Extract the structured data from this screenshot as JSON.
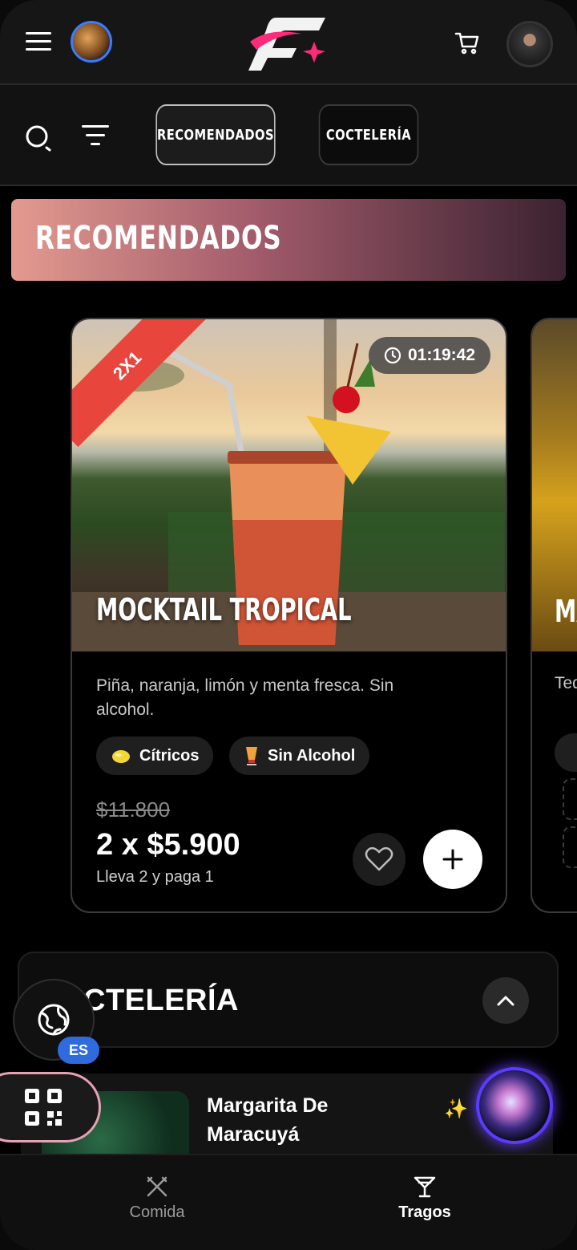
{
  "header": {
    "menu_icon": "hamburger-menu-icon",
    "venue_icon": "planet-icon",
    "logo": "brand-logo",
    "cart_icon": "shopping-cart-icon",
    "avatar_icon": "user-avatar"
  },
  "filters": {
    "search_icon": "search-icon",
    "filter_icon": "filter-icon",
    "tabs": [
      {
        "label": "RECOMENDADOS",
        "active": true
      },
      {
        "label": "COCTELERÍA",
        "active": false
      }
    ]
  },
  "banner": {
    "title": "RECOMENDADOS",
    "colors": [
      "#e39a8f",
      "#3b2230"
    ]
  },
  "featured_card": {
    "ribbon": "2X1",
    "ribbon_color": "#e8453d",
    "timer": "01:19:42",
    "title": "MOCKTAIL TROPICAL",
    "description": "Piña, naranja, limón y menta fresca. Sin alcohol.",
    "tags": [
      {
        "icon": "lemon-icon",
        "label": "Cítricos"
      },
      {
        "icon": "cocktail-glass-icon",
        "label": "Sin Alcohol"
      }
    ],
    "old_price": "$11.800",
    "price": "2 x $5.900",
    "price_note": "Lleva 2 y paga 1"
  },
  "next_card": {
    "title_fragment": "MA",
    "desc_fragment": "Teq"
  },
  "section": {
    "title": "CTELERÍA"
  },
  "language": {
    "code": "ES"
  },
  "list_item": {
    "name_line1": "Margarita De",
    "name_line2": "Maracuyá",
    "sparkle": "✨"
  },
  "bottom_nav": [
    {
      "label": "Comida",
      "icon": "fork-knife-icon",
      "active": false
    },
    {
      "label": "Tragos",
      "icon": "martini-glass-icon",
      "active": true
    }
  ]
}
